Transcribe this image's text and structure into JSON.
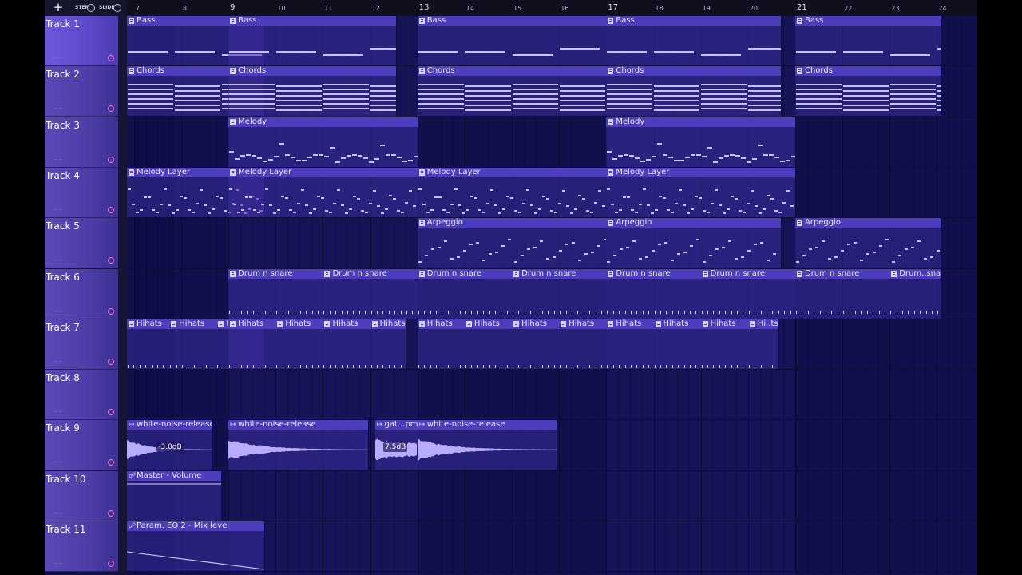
{
  "toolbar": {
    "add_label": "+",
    "step_label": "STEP",
    "slide_label": "SLIDE"
  },
  "ruler": {
    "bars": [
      "7",
      "8",
      "9",
      "10",
      "11",
      "12",
      "13",
      "14",
      "15",
      "16",
      "17",
      "18",
      "19",
      "20",
      "21",
      "22",
      "23",
      "24"
    ]
  },
  "tracks": [
    {
      "name": "Track 1"
    },
    {
      "name": "Track 2"
    },
    {
      "name": "Track 3"
    },
    {
      "name": "Track 4"
    },
    {
      "name": "Track 5"
    },
    {
      "name": "Track 6"
    },
    {
      "name": "Track 7"
    },
    {
      "name": "Track 8"
    },
    {
      "name": "Track 9"
    },
    {
      "name": "Track 10"
    },
    {
      "name": "Track 11"
    }
  ],
  "clips": [
    {
      "track": 0,
      "bar": 6.85,
      "len": 2.9,
      "name": "Bass",
      "kind": "bass"
    },
    {
      "track": 0,
      "bar": 9,
      "len": 3.55,
      "name": "Bass",
      "kind": "bass"
    },
    {
      "track": 0,
      "bar": 13,
      "len": 4,
      "name": "Bass",
      "kind": "bass"
    },
    {
      "track": 0,
      "bar": 17,
      "len": 3.7,
      "name": "Bass",
      "kind": "bass"
    },
    {
      "track": 0,
      "bar": 21,
      "len": 3.1,
      "name": "Bass",
      "kind": "bass"
    },
    {
      "track": 1,
      "bar": 6.85,
      "len": 2.9,
      "name": "Chords",
      "kind": "chords"
    },
    {
      "track": 1,
      "bar": 9,
      "len": 3.55,
      "name": "Chords",
      "kind": "chords"
    },
    {
      "track": 1,
      "bar": 13,
      "len": 4,
      "name": "Chords",
      "kind": "chords"
    },
    {
      "track": 1,
      "bar": 17,
      "len": 3.7,
      "name": "Chords",
      "kind": "chords"
    },
    {
      "track": 1,
      "bar": 21,
      "len": 3.1,
      "name": "Chords",
      "kind": "chords"
    },
    {
      "track": 2,
      "bar": 9,
      "len": 4,
      "name": "Melody",
      "kind": "melody"
    },
    {
      "track": 2,
      "bar": 17,
      "len": 4,
      "name": "Melody",
      "kind": "melody"
    },
    {
      "track": 3,
      "bar": 6.85,
      "len": 2.9,
      "name": "Melody Layer",
      "kind": "melody2"
    },
    {
      "track": 3,
      "bar": 9,
      "len": 4,
      "name": "Melody Layer",
      "kind": "melody2"
    },
    {
      "track": 3,
      "bar": 13,
      "len": 4,
      "name": "Melody Layer",
      "kind": "melody2"
    },
    {
      "track": 3,
      "bar": 17,
      "len": 4,
      "name": "Melody Layer",
      "kind": "melody2"
    },
    {
      "track": 4,
      "bar": 13,
      "len": 4,
      "name": "Arpeggio",
      "kind": "arp"
    },
    {
      "track": 4,
      "bar": 17,
      "len": 3.7,
      "name": "Arpeggio",
      "kind": "arp"
    },
    {
      "track": 4,
      "bar": 21,
      "len": 3.1,
      "name": "Arpeggio",
      "kind": "arp"
    },
    {
      "track": 5,
      "bar": 9,
      "len": 2,
      "name": "Drum n snare",
      "kind": "drum"
    },
    {
      "track": 5,
      "bar": 11,
      "len": 2,
      "name": "Drum n snare",
      "kind": "drum"
    },
    {
      "track": 5,
      "bar": 13,
      "len": 2,
      "name": "Drum n snare",
      "kind": "drum"
    },
    {
      "track": 5,
      "bar": 15,
      "len": 2,
      "name": "Drum n snare",
      "kind": "drum"
    },
    {
      "track": 5,
      "bar": 17,
      "len": 2,
      "name": "Drum n snare",
      "kind": "drum"
    },
    {
      "track": 5,
      "bar": 19,
      "len": 2,
      "name": "Drum n snare",
      "kind": "drum"
    },
    {
      "track": 5,
      "bar": 21,
      "len": 2,
      "name": "Drum n snare",
      "kind": "drum"
    },
    {
      "track": 5,
      "bar": 23,
      "len": 1.1,
      "name": "Drum..snare",
      "kind": "drum"
    },
    {
      "track": 6,
      "bar": 6.85,
      "len": 0.9,
      "name": "Hihats",
      "kind": "hat"
    },
    {
      "track": 6,
      "bar": 7.75,
      "len": 1,
      "name": "Hihats",
      "kind": "hat"
    },
    {
      "track": 6,
      "bar": 8.75,
      "len": 1,
      "name": "Hihats",
      "kind": "hat"
    },
    {
      "track": 6,
      "bar": 9,
      "len": 1,
      "name": "Hihats",
      "kind": "hat"
    },
    {
      "track": 6,
      "bar": 10,
      "len": 1,
      "name": "Hihats",
      "kind": "hat"
    },
    {
      "track": 6,
      "bar": 11,
      "len": 1,
      "name": "Hihats",
      "kind": "hat"
    },
    {
      "track": 6,
      "bar": 12,
      "len": 0.75,
      "name": "Hihats",
      "kind": "hat"
    },
    {
      "track": 6,
      "bar": 13,
      "len": 1,
      "name": "Hihats",
      "kind": "hat"
    },
    {
      "track": 6,
      "bar": 14,
      "len": 1,
      "name": "Hihats",
      "kind": "hat"
    },
    {
      "track": 6,
      "bar": 15,
      "len": 1,
      "name": "Hihats",
      "kind": "hat"
    },
    {
      "track": 6,
      "bar": 16,
      "len": 1,
      "name": "Hihats",
      "kind": "hat"
    },
    {
      "track": 6,
      "bar": 17,
      "len": 1,
      "name": "Hihats",
      "kind": "hat"
    },
    {
      "track": 6,
      "bar": 18,
      "len": 1,
      "name": "Hihats",
      "kind": "hat"
    },
    {
      "track": 6,
      "bar": 19,
      "len": 1,
      "name": "Hihats",
      "kind": "hat"
    },
    {
      "track": 6,
      "bar": 20,
      "len": 0.65,
      "name": "Hi..ts",
      "kind": "hat"
    },
    {
      "track": 8,
      "bar": 6.85,
      "len": 1.8,
      "name": "white-noise-release",
      "kind": "audio",
      "gain": "-3.0dB"
    },
    {
      "track": 8,
      "bar": 9,
      "len": 2.95,
      "name": "white-noise-release",
      "kind": "audio"
    },
    {
      "track": 8,
      "bar": 12.1,
      "len": 0.9,
      "name": "gat...pm",
      "kind": "audio2",
      "gain": "7.5dB"
    },
    {
      "track": 8,
      "bar": 13,
      "len": 2.95,
      "name": "white-noise-release",
      "kind": "audio"
    },
    {
      "track": 9,
      "bar": 6.85,
      "len": 2,
      "name": "Master - Volume",
      "kind": "auto_flat"
    },
    {
      "track": 10,
      "bar": 6.85,
      "len": 2.9,
      "name": "Param. EQ 2 - Mix level",
      "kind": "auto_ramp"
    }
  ],
  "colors": {
    "clip_header": "#4b3dbc",
    "clip_body": "#3a2e9e",
    "note": "#c9c0ff",
    "track_head": "#5a4ab8",
    "background": "#141457"
  }
}
